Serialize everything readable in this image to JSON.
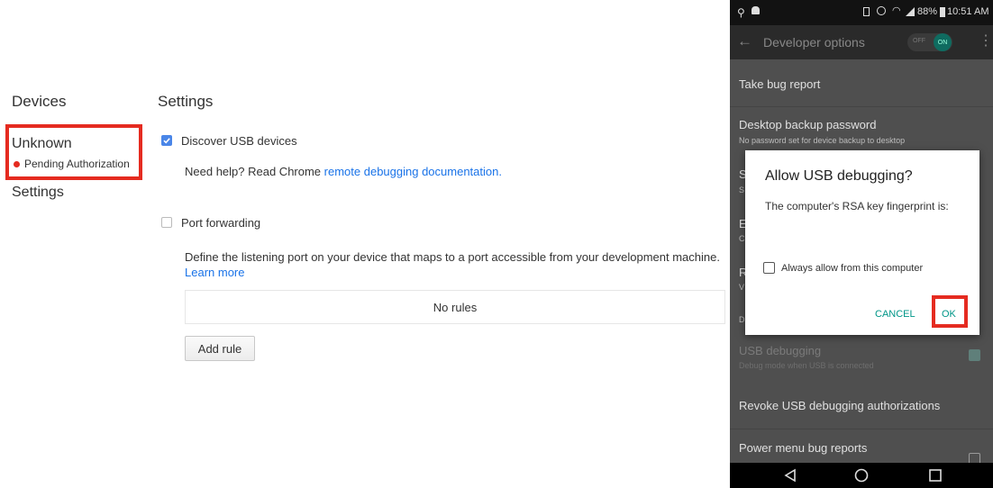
{
  "devtools": {
    "devices_heading": "Devices",
    "settings_heading": "Settings",
    "device": {
      "name": "Unknown",
      "status": "Pending Authorization"
    },
    "nav_settings": "Settings",
    "discover_usb": {
      "label": "Discover USB devices",
      "checked": true
    },
    "help": {
      "prefix": "Need help? Read Chrome ",
      "link": "remote debugging documentation."
    },
    "port_forwarding": {
      "label": "Port forwarding",
      "checked": false
    },
    "port_desc": {
      "text": "Define the listening port on your device that maps to a port accessible from your development machine. ",
      "link": "Learn more"
    },
    "rules_empty": "No rules",
    "add_rule": "Add rule",
    "colors": {
      "highlight": "#e52b20",
      "checkbox": "#4a86e8",
      "link": "#1a73e8"
    }
  },
  "phone": {
    "status": {
      "battery": "88%",
      "time": "10:51 AM"
    },
    "toolbar": {
      "title": "Developer options",
      "toggle_off": "OFF",
      "toggle_on": "ON"
    },
    "rows": {
      "take_bug_report": "Take bug report",
      "desktop_backup": {
        "title": "Desktop backup password",
        "sub": "No password set for device backup to desktop"
      },
      "usb_debugging": {
        "title": "USB debugging",
        "sub": "Debug mode when USB is connected"
      },
      "revoke": "Revoke USB debugging authorizations",
      "power_menu": "Power menu bug reports"
    },
    "partial_rows": {
      "s_row": "S",
      "s_row_sub": "S",
      "e_row": "E",
      "e_row_sub": "C",
      "r_row": "R",
      "r_row_sub": "V",
      "d_row": "D"
    },
    "dialog": {
      "title": "Allow USB debugging?",
      "body": "The computer's RSA key fingerprint is:",
      "always_allow": "Always allow from this computer",
      "cancel": "CANCEL",
      "ok": "OK"
    },
    "colors": {
      "accent": "#009688",
      "highlight": "#e52b20"
    }
  }
}
